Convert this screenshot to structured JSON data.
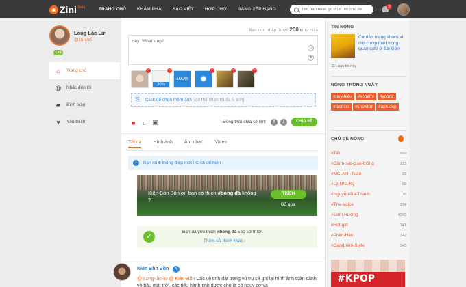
{
  "brand": {
    "name": "Zini",
    "beta": "Beta"
  },
  "nav": [
    "TRANG CHỦ",
    "KHÁM PHÁ",
    "SAO VIỆT",
    "HỢP CHỢ",
    "BẢNG XẾP HẠNG"
  ],
  "search": {
    "placeholder": "Tìm bạn hoặc gõ # để tìm chủ đề"
  },
  "notifications": {
    "count": "9"
  },
  "profile": {
    "name": "Long Lắc Lư",
    "handle": "@zonion",
    "level": "Lv5"
  },
  "menu": [
    "Trang chủ",
    "Nhắc đến tôi",
    "Bình luận",
    "Yêu thích"
  ],
  "composer": {
    "hint_prefix": "Bạn còn nhập được",
    "hint_count": "200",
    "hint_suffix": "kí tự nữa",
    "placeholder": "Hey! What's up?",
    "upload_percent": "30%",
    "done_label": "100%",
    "picker_link": "Click để chọn thêm ảnh",
    "picker_note": "(có thể chọn tối đa 5 ảnh)",
    "share_label": "Đồng thời chia sẻ lên:",
    "share_button": "CHIA SẺ"
  },
  "tabs": [
    "Tất cả",
    "Hình ảnh",
    "Âm nhạc",
    "Video"
  ],
  "notice": {
    "prefix": "Bạn có",
    "count": "6",
    "suffix": "thông điệp mới ! Click để hiện"
  },
  "banner": {
    "text_a": "Kiên Bồn Bồn ơi, bạn có thích",
    "tag": "#bóng đá",
    "text_b": "không ?",
    "like": "THÍCH",
    "skip": "Bỏ qua"
  },
  "confirm": {
    "prefix": "Bạn đã yêu thích",
    "tag": "#bóng đá",
    "suffix": "vào sở thích.",
    "link": "Thêm sở thích khác ›"
  },
  "post": {
    "author": "Kiên Bồn Bồn",
    "mention1": "@ Long-lắc-lư",
    "mention2": "@ Kiên-Bồn",
    "text_a": "Các vệ tinh đặt trong vũ trụ sẽ ghi lại hình ảnh",
    "text_b": "toàn cảnh về bầu mặt trời, các tiểu hành tinh được cho là có nguy cơ va"
  },
  "right": {
    "hot_title": "TIN NÓNG",
    "hot_story": "Cư dân mạng shock vì clip cướp Ipad trong quán café ở Sài Gòn",
    "hot_more": "Loan tin này",
    "trend_title": "NÓNG TRONG NGÀY",
    "tags": [
      "#huy-hiệu",
      "#xonefm",
      "#yoona",
      "#fashion",
      "#showbiz",
      "#ảnh-đẹp"
    ],
    "topics_title": "CHỦ ĐỀ NÓNG",
    "topics": [
      {
        "name": "#Tết",
        "count": "669"
      },
      {
        "name": "#Cảnh-sát-giao-thông",
        "count": "123"
      },
      {
        "name": "#MC-Anh-Tuấn",
        "count": "23"
      },
      {
        "name": "#Lý-Nhã-Kỳ",
        "count": "58"
      },
      {
        "name": "#Nguyễn-Bá-Thanh",
        "count": "76"
      },
      {
        "name": "#The-Voice",
        "count": "234"
      },
      {
        "name": "#Đinh-Hương",
        "count": "4369"
      },
      {
        "name": "#Hot-girl",
        "count": "341"
      },
      {
        "name": "#Phim-Hàn",
        "count": "142"
      },
      {
        "name": "#Gangnam-Style",
        "count": "945"
      }
    ],
    "ad_text": "#KPOP"
  }
}
